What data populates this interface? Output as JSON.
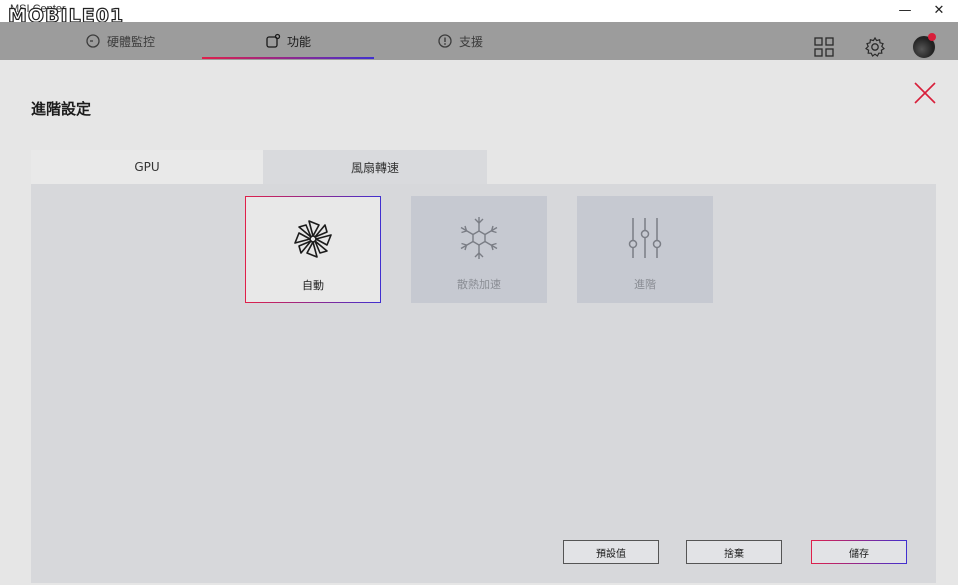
{
  "window": {
    "app_title": "MSI Center",
    "watermark": "MOBILE01",
    "minimize_glyph": "—",
    "close_glyph": "✕"
  },
  "nav": {
    "tabs": [
      {
        "label": "硬體監控",
        "icon": "gauge-icon"
      },
      {
        "label": "功能",
        "icon": "feature-icon"
      },
      {
        "label": "支援",
        "icon": "support-icon"
      }
    ],
    "active_tab": 1,
    "right_icons": [
      "grid-icon",
      "gear-icon",
      "avatar"
    ]
  },
  "page": {
    "title": "進階設定",
    "subtabs": [
      "GPU",
      "風扇轉速"
    ],
    "active_subtab": 1
  },
  "modes": [
    {
      "label": "自動",
      "icon": "fan-icon",
      "selected": true
    },
    {
      "label": "散熱加速",
      "icon": "snowflake-icon",
      "selected": false
    },
    {
      "label": "進階",
      "icon": "sliders-icon",
      "selected": false
    }
  ],
  "actions": {
    "default_label": "預設值",
    "discard_label": "捨棄",
    "save_label": "儲存"
  },
  "colors": {
    "accent_start": "#e0204a",
    "accent_end": "#4030d0",
    "close_x": "#d81e3a"
  }
}
